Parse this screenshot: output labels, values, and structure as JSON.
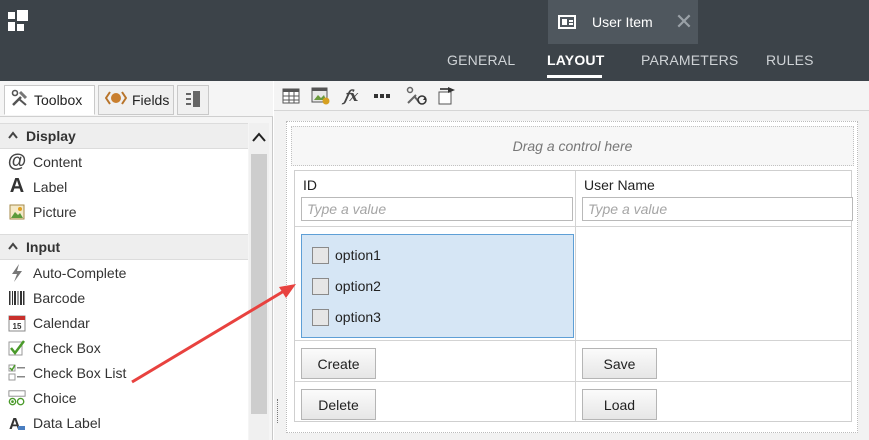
{
  "header": {
    "doc_tab_label": "User Item",
    "nav": [
      {
        "label": "GENERAL",
        "active": false
      },
      {
        "label": "LAYOUT",
        "active": true
      },
      {
        "label": "PARAMETERS",
        "active": false
      },
      {
        "label": "RULES",
        "active": false
      }
    ]
  },
  "left_panel": {
    "tabs": [
      {
        "label": "Toolbox",
        "icon": "tools-icon"
      },
      {
        "label": "Fields",
        "icon": "fields-icon"
      },
      {
        "label": "",
        "icon": "outline-icon"
      }
    ],
    "sections": [
      {
        "title": "Display",
        "items": [
          {
            "label": "Content",
            "icon": "at-icon"
          },
          {
            "label": "Label",
            "icon": "letter-a-icon"
          },
          {
            "label": "Picture",
            "icon": "picture-icon"
          }
        ]
      },
      {
        "title": "Input",
        "items": [
          {
            "label": "Auto-Complete",
            "icon": "lightning-icon"
          },
          {
            "label": "Barcode",
            "icon": "barcode-icon"
          },
          {
            "label": "Calendar",
            "icon": "calendar-icon"
          },
          {
            "label": "Check Box",
            "icon": "checkbox-icon"
          },
          {
            "label": "Check Box List",
            "icon": "checkbox-list-icon"
          },
          {
            "label": "Choice",
            "icon": "choice-icon"
          },
          {
            "label": "Data Label",
            "icon": "data-label-icon"
          }
        ]
      }
    ],
    "calendar_icon_text": "15"
  },
  "editor": {
    "dropzone_text": "Drag a control here",
    "fields": [
      {
        "label": "ID",
        "placeholder": "Type a value"
      },
      {
        "label": "User Name",
        "placeholder": "Type a value"
      }
    ],
    "checkbox_list": {
      "options": [
        "option1",
        "option2",
        "option3"
      ]
    },
    "buttons": {
      "create": "Create",
      "save": "Save",
      "delete": "Delete",
      "load": "Load"
    }
  },
  "colors": {
    "topbar": "#3c4349",
    "selection_fill": "#d6e6f5",
    "selection_border": "#5e9fd6",
    "annotation_arrow": "#e8423f"
  }
}
